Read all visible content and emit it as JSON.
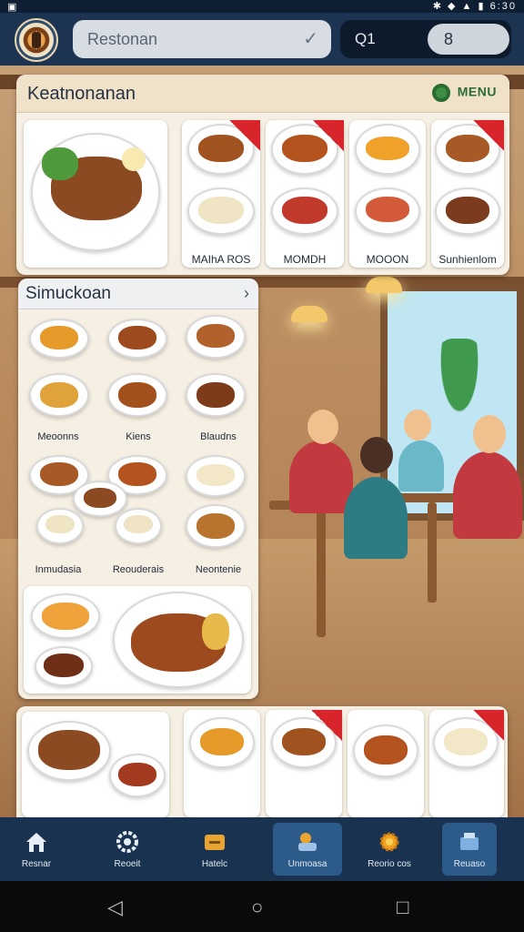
{
  "status_bar": {
    "left": "▣",
    "right": "✱ ◆ ▲ ▮ 6:30"
  },
  "header": {
    "search_text": "Restonan",
    "search_check": "✓",
    "q_label": "Q1",
    "toggle_value": "8"
  },
  "main_panel": {
    "title": "Keatnonanan",
    "menu_label": "MENU",
    "items": [
      {
        "label": "MAIhA ROS"
      },
      {
        "label": "MOMDH"
      },
      {
        "label": "MOOON"
      },
      {
        "label": "Sunhienlom"
      }
    ]
  },
  "sub_panel": {
    "title": "Simuckoan",
    "chevron": "›",
    "row1_labels": [
      "Meoonns",
      "Kiens",
      "Blaudns"
    ],
    "row2_labels": [
      "Inmudasia",
      "Reouderais",
      "Neontenie"
    ]
  },
  "bottom_nav": {
    "items": [
      {
        "label": "Resnar",
        "icon": "home-icon"
      },
      {
        "label": "Reoeit",
        "icon": "gear-icon"
      },
      {
        "label": "Hatelc",
        "icon": "folder-icon"
      },
      {
        "label": "Unmoasa",
        "icon": "chef-icon"
      },
      {
        "label": "Reorio cos",
        "icon": "flower-icon"
      },
      {
        "label": "Reuaso",
        "icon": "store-icon"
      }
    ]
  },
  "system_nav": {
    "back": "◁",
    "home": "○",
    "recents": "□"
  },
  "colors": {
    "header": "#1c3452",
    "nav": "#18324f",
    "accent_red": "#d8242b",
    "menu_green": "#2d6a3a"
  }
}
